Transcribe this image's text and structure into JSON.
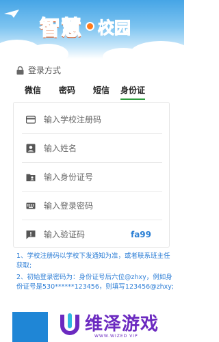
{
  "header": {
    "logo_main": "智慧",
    "logo_sub": "校园"
  },
  "login": {
    "section_title": "登录方式",
    "tabs": [
      {
        "label": "微信"
      },
      {
        "label": "密码"
      },
      {
        "label": "短信"
      },
      {
        "label": "身份证",
        "active": true
      }
    ],
    "fields": [
      {
        "placeholder": "输入学校注册码",
        "icon": "card-icon"
      },
      {
        "placeholder": "输入姓名",
        "icon": "person-icon"
      },
      {
        "placeholder": "输入身份证号",
        "icon": "folder-person-icon"
      },
      {
        "placeholder": "输入登录密码",
        "icon": "keyboard-icon"
      },
      {
        "placeholder": "输入验证码",
        "icon": "alert-icon"
      }
    ],
    "captcha": "fa99"
  },
  "notes": [
    "1、学校注册码以学校下发通知为准，或者联系班主任获取;",
    "2、初始登录密码为：身份证号后六位@zhxy，例如身份证号是530******123456，则填写123456@zhxy;"
  ],
  "watermark": {
    "text": "维泽游戏",
    "url": "WWW.WIZED VIP"
  },
  "colors": {
    "accent": "#2e9b3d",
    "link": "#2f7fd6",
    "brand_orange": "#ff7a1a",
    "bottom_button": "#1f86d6"
  }
}
